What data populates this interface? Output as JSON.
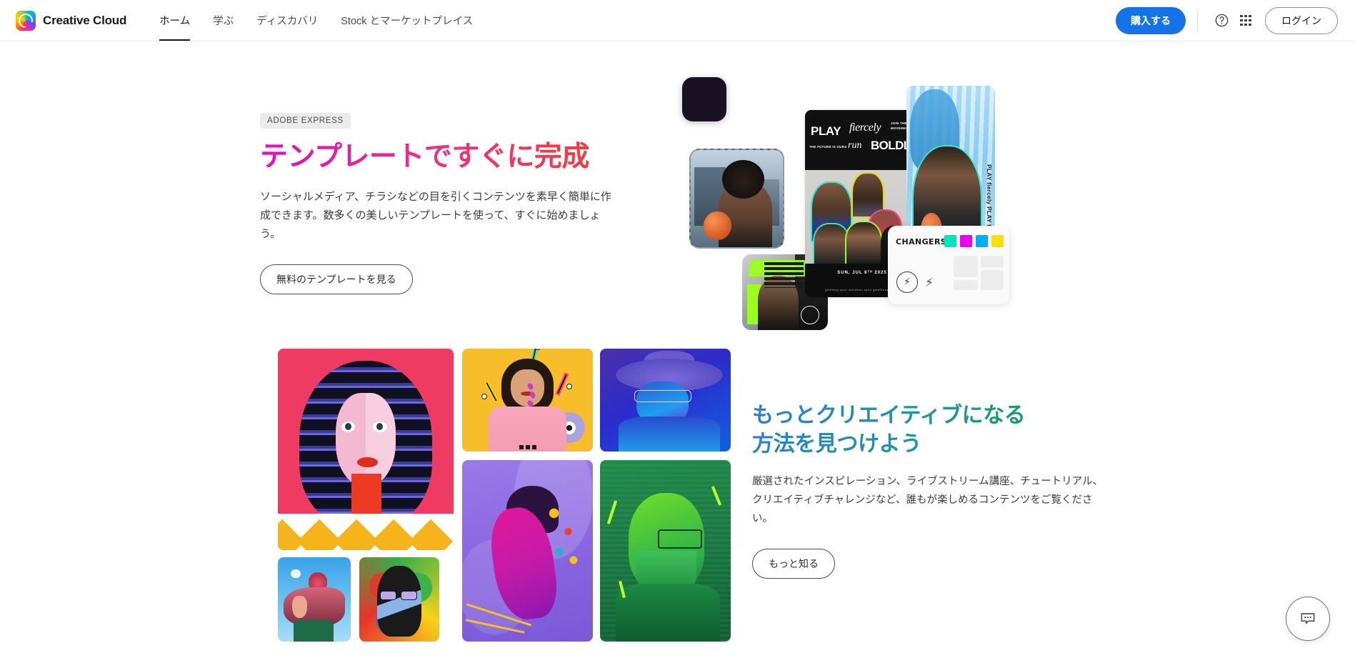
{
  "header": {
    "brand": "Creative Cloud",
    "logo_icon": "creative-cloud-logo",
    "nav": [
      {
        "label": "ホーム",
        "active": true
      },
      {
        "label": "学ぶ",
        "active": false
      },
      {
        "label": "ディスカバリ",
        "active": false
      },
      {
        "label": "Stock とマーケットプレイス",
        "active": false
      }
    ],
    "buy_label": "購入する",
    "help_icon": "help-circle-icon",
    "apps_icon": "app-grid-icon",
    "login_label": "ログイン",
    "accent_blue": "#1473e6"
  },
  "hero": {
    "eyebrow": "ADOBE EXPRESS",
    "title": "テンプレートですぐに完成",
    "body": "ソーシャルメディア、チラシなどの目を引くコンテンツを素早く簡単に作成できます。数多くの美しいテンプレートを使って、すぐに始めましょう。",
    "cta": "無料のテンプレートを見る",
    "title_gradient_from": "#e30bc4",
    "title_gradient_to": "#f5402c",
    "collage": {
      "app_icon": "adobe-express-app-icon",
      "poster": {
        "play": "PLAY",
        "fiercely": "fiercely",
        "run": "run",
        "boldly": "BOLDLY",
        "join": "JOIN THE MOVEMENT",
        "future": "THE FUTURE IS OURS",
        "footer_title": "SUN, JUL 6ᵀᴴ 2025",
        "footer_sub": "getfitboy.sport        marathon.sport        goldfitness.sport"
      },
      "vertical_text": "PLAY fiercely PLAY fiercely",
      "panel": {
        "title": "CHANGERS",
        "swatches": [
          "#00e5c0",
          "#f000f0",
          "#00aeef",
          "#ffe000"
        ],
        "seal_icon": "lightning-seal-icon",
        "bolt_icon": "lightning-bolt-icon"
      }
    }
  },
  "section2": {
    "title_line1": "もっとクリエイティブになる",
    "title_line2": "方法を見つけよう",
    "body": "厳選されたインスピレーション、ライブストリーム講座、チュートリアル、クリエイティブチャレンジなど、誰もが楽しめるコンテンツをご覧ください。",
    "cta": "もっと知る",
    "title_gradient_from": "#2a7fd4",
    "title_gradient_to": "#179c5a",
    "gallery": [
      {
        "name": "illustrated-woman-red"
      },
      {
        "name": "yellow-portrait-photo"
      },
      {
        "name": "blue-hat-portrait"
      },
      {
        "name": "blue-flower-girl"
      },
      {
        "name": "rainbow-paint-portrait"
      },
      {
        "name": "purple-psychedelic-portrait"
      },
      {
        "name": "green-glasses-portrait"
      }
    ]
  },
  "chat": {
    "icon": "chat-bubble-icon",
    "label": "チャット"
  }
}
